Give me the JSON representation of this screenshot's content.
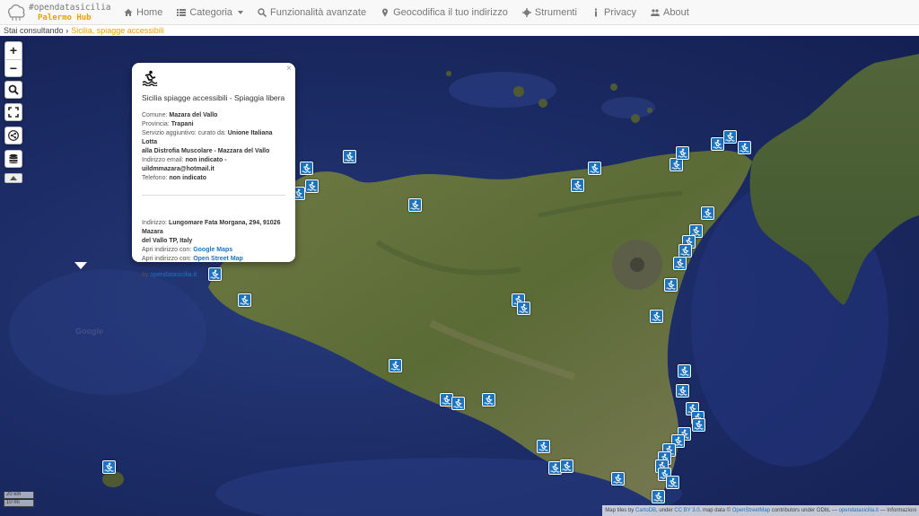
{
  "brand": {
    "line1": "#opendatasicilia",
    "line2": "Palermo Hub"
  },
  "nav": {
    "home": "Home",
    "categoria": "Categoria",
    "funzionalita": "Funzionalità avanzate",
    "geocodifica": "Geocodifica il tuo indirizzo",
    "strumenti": "Strumenti",
    "privacy": "Privacy",
    "about": "About"
  },
  "breadcrumb": {
    "label": "Stai consultando",
    "current": "Sicilia, spiagge accessibili"
  },
  "controls": {
    "zoom_in": "+",
    "zoom_out": "−"
  },
  "popup": {
    "close": "×",
    "title": "Sicilia spiagge accessibili - Spiaggia libera",
    "comune_label": "Comune:",
    "comune_value": "Mazara del Vallo",
    "provincia_label": "Provincia:",
    "provincia_value": "Trapani",
    "servizio_label": "Servizio aggiuntivo: curato da:",
    "servizio_value_1": "Unione Italiana Lotta",
    "servizio_value_2": "alla Distrofia Muscolare - Mazzara del Vallo",
    "email_label": "Indirizzo email:",
    "email_value": "non indicato - uildmmazara@hotmail.it",
    "telefono_label": "Telefono:",
    "telefono_value": "non indicato",
    "indirizzo_label": "Indirizzo:",
    "indirizzo_value_1": "Lungomare Fata Morgana, 294, 91026 Mazara",
    "indirizzo_value_2": "del Vallo TP, Italy",
    "apri_label": "Apri indirizzo con:",
    "google_maps": "Google Maps",
    "osm": "Open Street Map",
    "by_label": "by",
    "by_link": "opendatasicilia.it"
  },
  "scale": {
    "km": "20 km",
    "mi": "10 mi"
  },
  "attribution": {
    "prefix": "Map tiles by",
    "carto": "CartoDB",
    "under": ", under",
    "license": "CC BY 3.0",
    "map_data": ". map data ©",
    "osm": "OpenStreetMap",
    "contrib": "contributors under ODbL —",
    "site": "opendatasicilia.it",
    "info": "— Informazioni"
  },
  "icons": {
    "home": "home-icon",
    "categoria": "list-icon",
    "funzionalita": "search-icon",
    "geocodifica": "map-marker-icon",
    "strumenti": "gear-icon",
    "privacy": "info-icon",
    "about": "users-icon",
    "marker": "wheelchair-swimmer-icon"
  },
  "colors": {
    "accent": "#e8a200",
    "marker": "#1e73be",
    "sea": "#1c2c66",
    "land": "#5f6f3a"
  }
}
